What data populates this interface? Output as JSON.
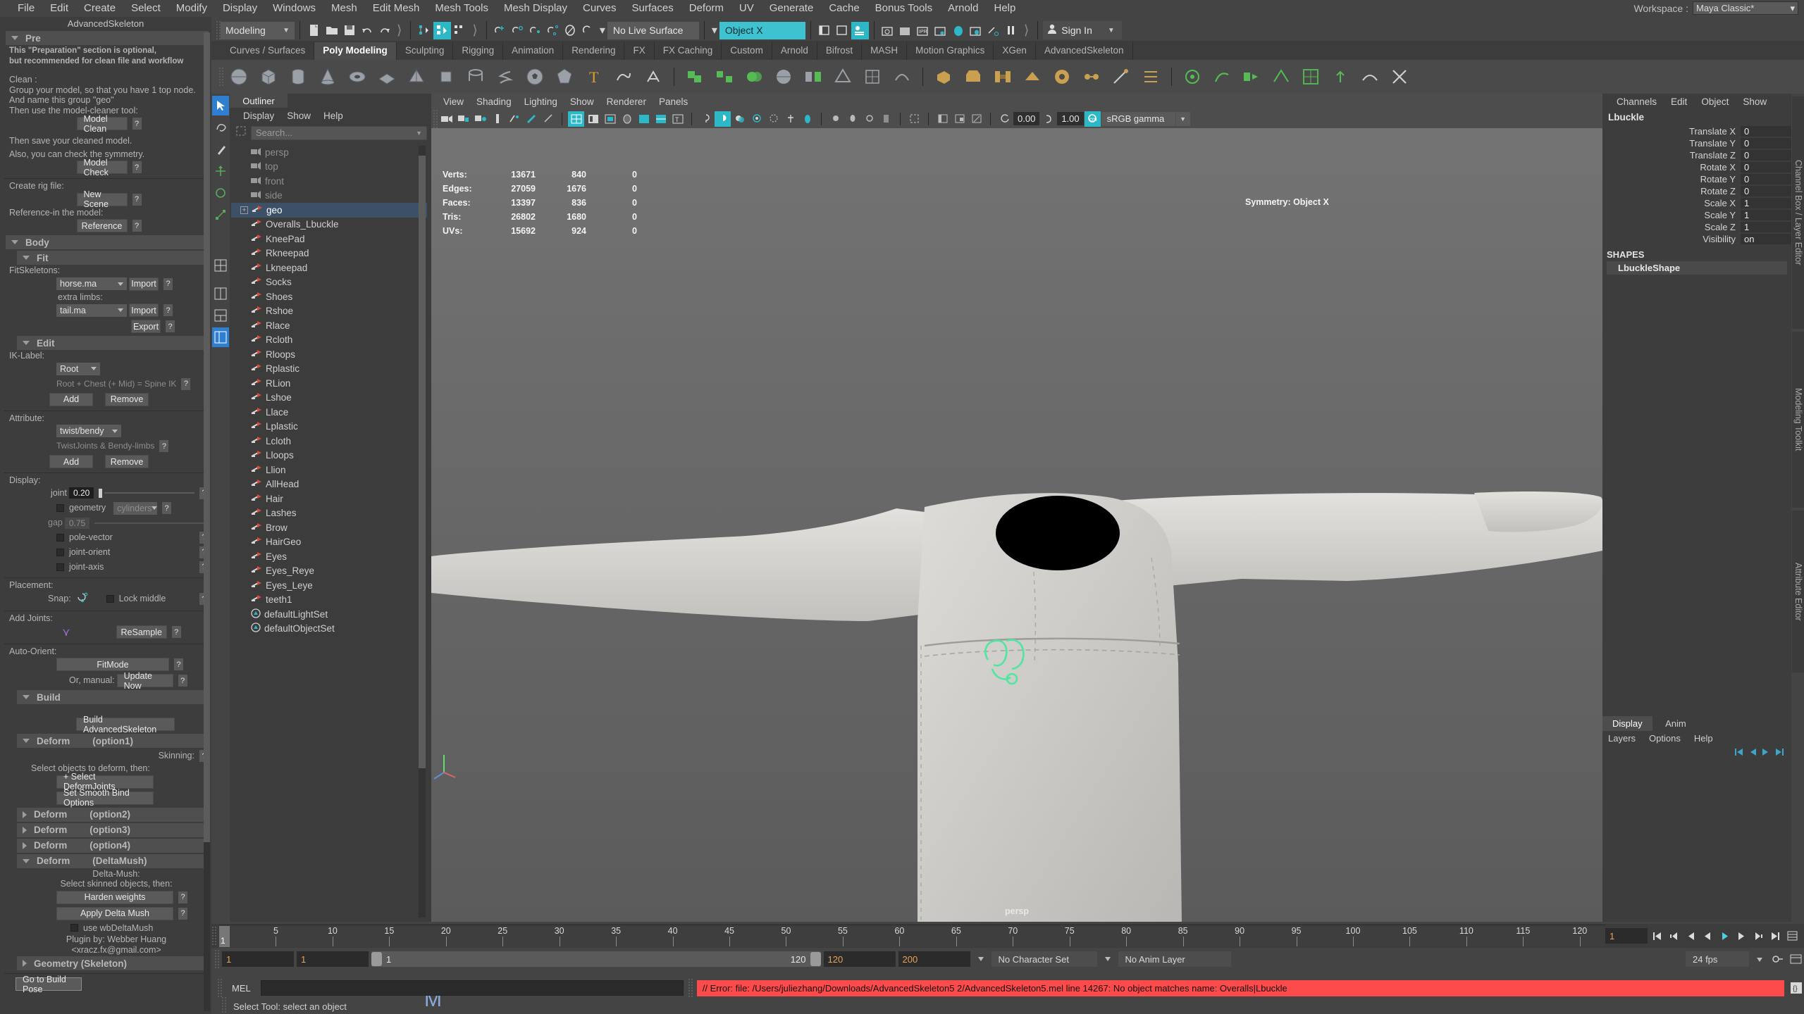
{
  "app": {
    "title": "Maya",
    "workspace_label": "Workspace :",
    "workspace_value": "Maya Classic*"
  },
  "menubar": {
    "items": [
      "File",
      "Edit",
      "Create",
      "Select",
      "Modify",
      "Display",
      "Windows",
      "Mesh",
      "Edit Mesh",
      "Mesh Tools",
      "Mesh Display",
      "Curves",
      "Surfaces",
      "Deform",
      "UV",
      "Generate",
      "Cache",
      "Bonus Tools",
      "Arnold",
      "Help"
    ]
  },
  "statusbar": {
    "menuset": "Modeling",
    "live_surface": "No Live Surface",
    "symmetry_field": "Object X",
    "sign_in": "Sign In"
  },
  "shelf": {
    "tabs": [
      "Curves / Surfaces",
      "Poly Modeling",
      "Sculpting",
      "Rigging",
      "Animation",
      "Rendering",
      "FX",
      "FX Caching",
      "Custom",
      "Arnold",
      "Bifrost",
      "MASH",
      "Motion Graphics",
      "XGen",
      "AdvancedSkeleton"
    ],
    "active_tab": "Poly Modeling"
  },
  "advanced_skeleton": {
    "title": "AdvancedSkeleton",
    "sections": {
      "pre": {
        "header": "Pre",
        "intro_line1": "This \"Preparation\" section is optional,",
        "intro_line2": "but recommended for clean file and workflow",
        "clean_label": "Clean :",
        "clean_line1": "Group your model, so that you have 1 top node.",
        "clean_line2": "And name this group \"geo\"",
        "clean_line3": "Then use the model-cleaner tool:",
        "model_clean_btn": "Model Clean",
        "save_line": "Then save your cleaned model.",
        "symmetry_line": "Also, you can check the symmetry.",
        "model_check_btn": "Model Check",
        "create_rig_label": "Create rig file:",
        "new_scene_btn": "New Scene",
        "reference_label": "Reference-in the model:",
        "reference_btn": "Reference"
      },
      "body": {
        "header": "Body"
      },
      "fit": {
        "header": "Fit",
        "fitskeletons_label": "FitSkeletons:",
        "fitskeletons_value": "horse.ma",
        "import_btn": "Import",
        "extra_limbs_label": "extra limbs:",
        "extra_limbs_value": "tail.ma",
        "import2_btn": "Import",
        "export_btn": "Export"
      },
      "edit": {
        "header": "Edit",
        "iklabel_label": "IK-Label:",
        "iklabel_value": "Root",
        "iklabel_hint": "Root + Chest (+ Mid) = Spine IK",
        "add_btn": "Add",
        "remove_btn": "Remove",
        "attribute_label": "Attribute:",
        "attribute_value": "twist/bendy",
        "attribute_hint": "TwistJoints & Bendy-limbs",
        "add2_btn": "Add",
        "remove2_btn": "Remove",
        "display_label": "Display:",
        "joint_label": "joint",
        "joint_value": "0.20",
        "geometry_label": "geometry",
        "geometry_type": "cylinders",
        "gap_label": "gap",
        "gap_value": "0.75",
        "pole_vector_label": "pole-vector",
        "joint_orient_label": "joint-orient",
        "joint_axis_label": "joint-axis",
        "placement_label": "Placement:",
        "snap_label": "Snap:",
        "lock_middle_label": "Lock middle",
        "add_joints_label": "Add Joints:",
        "resample_btn": "ReSample",
        "auto_orient_label": "Auto-Orient:",
        "fitmode_btn": "FitMode",
        "or_manual_label": "Or, manual:",
        "update_now_btn": "Update Now"
      },
      "build": {
        "header": "Build",
        "build_btn": "Build AdvancedSkeleton"
      },
      "deform1": {
        "header": "Deform",
        "suffix": "(option1)",
        "skinning_label": "Skinning:",
        "select_line": "Select objects to deform, then:",
        "select_deform_joints_btn": "+ Select DeformJoints",
        "smooth_bind_btn": "Set Smooth Bind Options"
      },
      "deform2": {
        "header": "Deform",
        "suffix": "(option2)"
      },
      "deform3": {
        "header": "Deform",
        "suffix": "(option3)"
      },
      "deform4": {
        "header": "Deform",
        "suffix": "(option4)"
      },
      "deltamush": {
        "header": "Deform",
        "suffix": "(DeltaMush)",
        "title_line": "Delta-Mush:",
        "select_line": "Select skinned objects, then:",
        "harden_btn": "Harden weights",
        "apply_btn": "Apply Delta Mush",
        "use_wb_label": "use wbDeltaMush",
        "plugin_line1": "Plugin by: Webber Huang",
        "plugin_line2": "<xracz.fx@gmail.com>"
      },
      "geometry": {
        "header": "Geometry (Skeleton)"
      },
      "build_pose_btn": "Go to Build Pose"
    }
  },
  "outliner": {
    "tab_label": "Outliner",
    "menu": [
      "Display",
      "Show",
      "Help"
    ],
    "search_placeholder": "Search...",
    "items": [
      {
        "label": "persp",
        "icon": "camera-icon",
        "dim": true,
        "selected": false,
        "expandable": false
      },
      {
        "label": "top",
        "icon": "camera-icon",
        "dim": true,
        "selected": false,
        "expandable": false
      },
      {
        "label": "front",
        "icon": "camera-icon",
        "dim": true,
        "selected": false,
        "expandable": false
      },
      {
        "label": "side",
        "icon": "camera-icon",
        "dim": true,
        "selected": false,
        "expandable": false
      },
      {
        "label": "geo",
        "icon": "transform-icon",
        "dim": false,
        "selected": true,
        "expandable": true
      },
      {
        "label": "Overalls_Lbuckle",
        "icon": "transform-icon",
        "dim": false,
        "selected": false,
        "expandable": false
      },
      {
        "label": "KneePad",
        "icon": "transform-icon",
        "dim": false,
        "selected": false,
        "expandable": false
      },
      {
        "label": "Rkneepad",
        "icon": "transform-icon",
        "dim": false,
        "selected": false,
        "expandable": false
      },
      {
        "label": "Lkneepad",
        "icon": "transform-icon",
        "dim": false,
        "selected": false,
        "expandable": false
      },
      {
        "label": "Socks",
        "icon": "transform-icon",
        "dim": false,
        "selected": false,
        "expandable": false
      },
      {
        "label": "Shoes",
        "icon": "transform-icon",
        "dim": false,
        "selected": false,
        "expandable": false
      },
      {
        "label": "Rshoe",
        "icon": "transform-icon",
        "dim": false,
        "selected": false,
        "expandable": false
      },
      {
        "label": "Rlace",
        "icon": "transform-icon",
        "dim": false,
        "selected": false,
        "expandable": false
      },
      {
        "label": "Rcloth",
        "icon": "transform-icon",
        "dim": false,
        "selected": false,
        "expandable": false
      },
      {
        "label": "Rloops",
        "icon": "transform-icon",
        "dim": false,
        "selected": false,
        "expandable": false
      },
      {
        "label": "Rplastic",
        "icon": "transform-icon",
        "dim": false,
        "selected": false,
        "expandable": false
      },
      {
        "label": "RLion",
        "icon": "transform-icon",
        "dim": false,
        "selected": false,
        "expandable": false
      },
      {
        "label": "Lshoe",
        "icon": "transform-icon",
        "dim": false,
        "selected": false,
        "expandable": false
      },
      {
        "label": "Llace",
        "icon": "transform-icon",
        "dim": false,
        "selected": false,
        "expandable": false
      },
      {
        "label": "Lplastic",
        "icon": "transform-icon",
        "dim": false,
        "selected": false,
        "expandable": false
      },
      {
        "label": "Lcloth",
        "icon": "transform-icon",
        "dim": false,
        "selected": false,
        "expandable": false
      },
      {
        "label": "Lloops",
        "icon": "transform-icon",
        "dim": false,
        "selected": false,
        "expandable": false
      },
      {
        "label": "Llion",
        "icon": "transform-icon",
        "dim": false,
        "selected": false,
        "expandable": false
      },
      {
        "label": "AllHead",
        "icon": "transform-icon",
        "dim": false,
        "selected": false,
        "expandable": false
      },
      {
        "label": "Hair",
        "icon": "transform-icon",
        "dim": false,
        "selected": false,
        "expandable": false
      },
      {
        "label": "Lashes",
        "icon": "transform-icon",
        "dim": false,
        "selected": false,
        "expandable": false
      },
      {
        "label": "Brow",
        "icon": "transform-icon",
        "dim": false,
        "selected": false,
        "expandable": false
      },
      {
        "label": "HairGeo",
        "icon": "transform-icon",
        "dim": false,
        "selected": false,
        "expandable": false
      },
      {
        "label": "Eyes",
        "icon": "transform-icon",
        "dim": false,
        "selected": false,
        "expandable": false
      },
      {
        "label": "Eyes_Reye",
        "icon": "transform-icon",
        "dim": false,
        "selected": false,
        "expandable": false
      },
      {
        "label": "Eyes_Leye",
        "icon": "transform-icon",
        "dim": false,
        "selected": false,
        "expandable": false
      },
      {
        "label": "teeth1",
        "icon": "transform-icon",
        "dim": false,
        "selected": false,
        "expandable": false
      },
      {
        "label": "defaultLightSet",
        "icon": "set-icon",
        "dim": false,
        "selected": false,
        "expandable": false
      },
      {
        "label": "defaultObjectSet",
        "icon": "set-icon",
        "dim": false,
        "selected": false,
        "expandable": false
      }
    ]
  },
  "viewport": {
    "menu": [
      "View",
      "Shading",
      "Lighting",
      "Show",
      "Renderer",
      "Panels"
    ],
    "exposure_value": "0.00",
    "gamma_value": "1.00",
    "color_space": "sRGB gamma",
    "camera_label": "persp",
    "symmetry_hud": "Symmetry: Object X",
    "heads_up": {
      "rows": [
        {
          "label": "Verts:",
          "total": "13671",
          "selected": "840",
          "extra": "0"
        },
        {
          "label": "Edges:",
          "total": "27059",
          "selected": "1676",
          "extra": "0"
        },
        {
          "label": "Faces:",
          "total": "13397",
          "selected": "836",
          "extra": "0"
        },
        {
          "label": "Tris:",
          "total": "26802",
          "selected": "1680",
          "extra": "0"
        },
        {
          "label": "UVs:",
          "total": "15692",
          "selected": "924",
          "extra": "0"
        }
      ]
    }
  },
  "channelbox": {
    "menu": [
      "Channels",
      "Edit",
      "Object",
      "Show"
    ],
    "object_name": "Lbuckle",
    "attributes": [
      {
        "name": "Translate X",
        "value": "0"
      },
      {
        "name": "Translate Y",
        "value": "0"
      },
      {
        "name": "Translate Z",
        "value": "0"
      },
      {
        "name": "Rotate X",
        "value": "0"
      },
      {
        "name": "Rotate Y",
        "value": "0"
      },
      {
        "name": "Rotate Z",
        "value": "0"
      },
      {
        "name": "Scale X",
        "value": "1"
      },
      {
        "name": "Scale Y",
        "value": "1"
      },
      {
        "name": "Scale Z",
        "value": "1"
      },
      {
        "name": "Visibility",
        "value": "on"
      }
    ],
    "shapes_header": "SHAPES",
    "shape_name": "LbuckleShape",
    "side_tabs": [
      "Channel Box / Layer Editor",
      "Modeling Toolkit",
      "Attribute Editor"
    ],
    "display_tab": "Display",
    "anim_tab": "Anim",
    "layer_menu": [
      "Layers",
      "Options",
      "Help"
    ]
  },
  "timeline": {
    "current_frame": "1",
    "tick_labels": [
      "5",
      "10",
      "15",
      "20",
      "25",
      "30",
      "35",
      "40",
      "45",
      "50",
      "55",
      "60",
      "65",
      "70",
      "75",
      "80",
      "85",
      "90",
      "95",
      "100",
      "105",
      "110",
      "115",
      "120"
    ],
    "start_field": "1",
    "end_field": "1",
    "range_start": "1",
    "range_end": "120",
    "anim_start": "120",
    "anim_end": "200",
    "character_set": "No Character Set",
    "anim_layer": "No Anim Layer",
    "fps": "24 fps"
  },
  "command_line": {
    "language_label": "MEL",
    "input_value": "",
    "error_message": "// Error: file: /Users/juliezhang/Downloads/AdvancedSkeleton5 2/AdvancedSkeleton5.mel line 14267: No object matches name: Overalls|Lbuckle"
  },
  "help_line": {
    "text": "Select Tool: select an object"
  }
}
